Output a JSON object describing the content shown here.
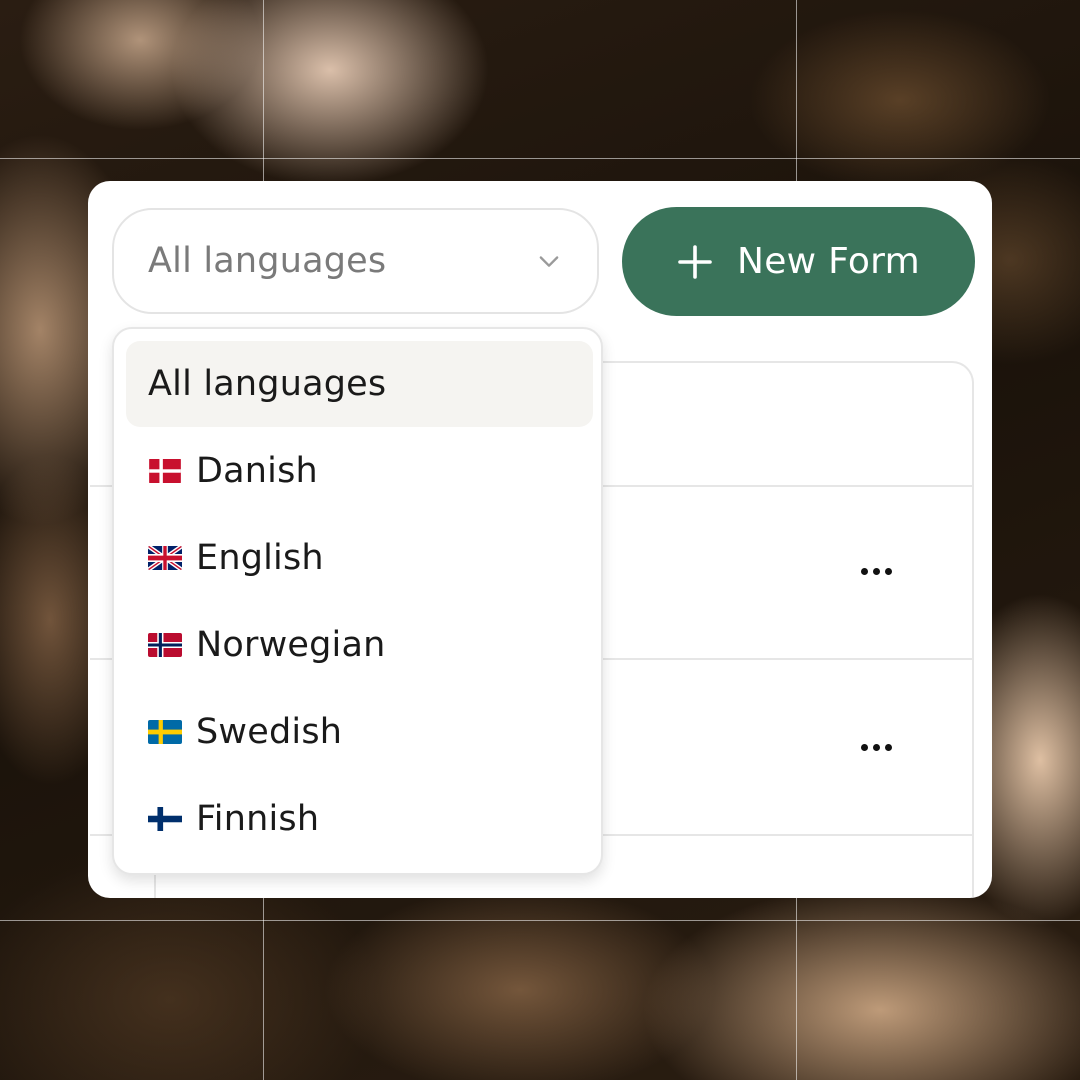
{
  "filter": {
    "selected_value": "All languages",
    "icon": "chevron-down-icon"
  },
  "new_form_button": {
    "label": "New Form",
    "icon": "plus-icon",
    "color": "#3a735a"
  },
  "dropdown": {
    "options": [
      {
        "label": "All languages",
        "flag": null,
        "selected": true
      },
      {
        "label": "Danish",
        "flag": "danish-flag-icon",
        "selected": false
      },
      {
        "label": "English",
        "flag": "uk-flag-icon",
        "selected": false
      },
      {
        "label": "Norwegian",
        "flag": "norwegian-flag-icon",
        "selected": false
      },
      {
        "label": "Swedish",
        "flag": "swedish-flag-icon",
        "selected": false
      },
      {
        "label": "Finnish",
        "flag": "finnish-flag-icon",
        "selected": false
      }
    ]
  },
  "table": {
    "row_actions_icon": "more-options-icon"
  },
  "colors": {
    "card_background": "#ffffff",
    "selected_option_background": "#f5f4f1",
    "border": "#e6e6e6"
  }
}
